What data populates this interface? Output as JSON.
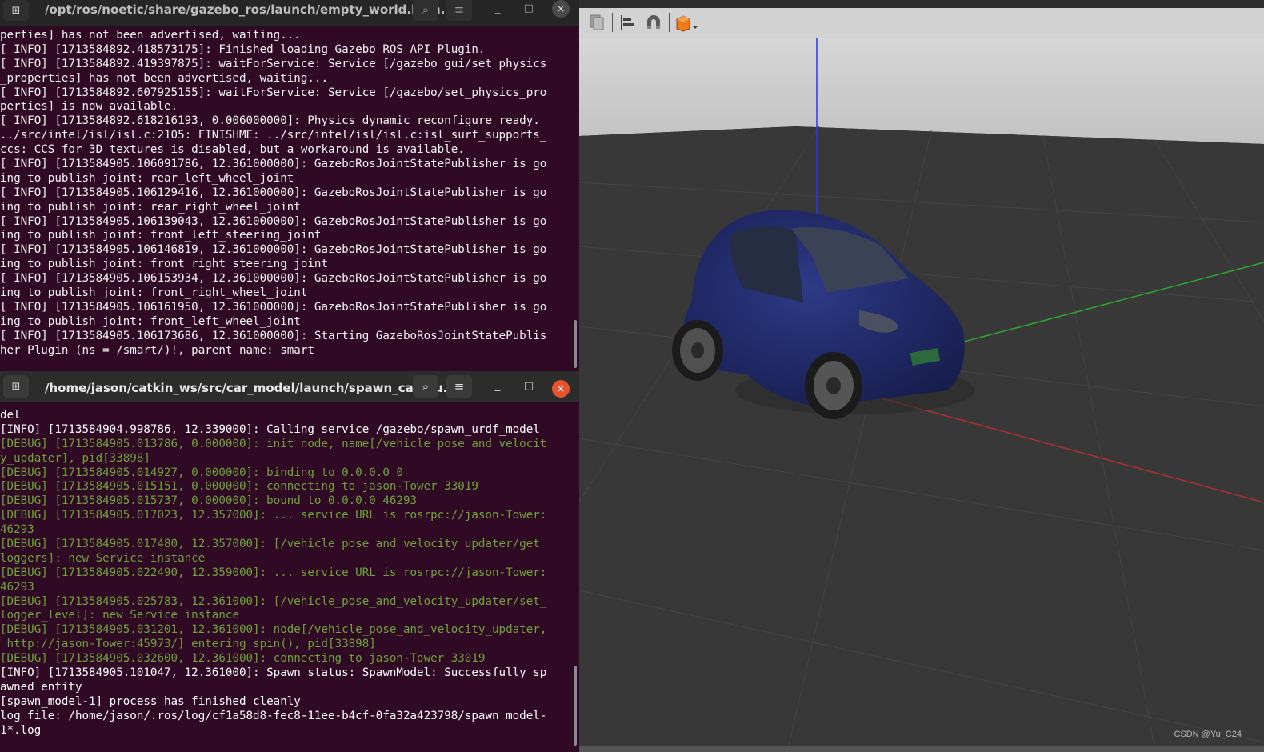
{
  "terminal_top": {
    "title": "/opt/ros/noetic/share/gazebo_ros/launch/empty_world.laun...",
    "lines": [
      {
        "text": "perties] has not been advertised, waiting...",
        "level": "plain"
      },
      {
        "text": "[ INFO] [1713584892.418573175]: Finished loading Gazebo ROS API Plugin.",
        "level": "plain"
      },
      {
        "text": "[ INFO] [1713584892.419397875]: waitForService: Service [/gazebo_gui/set_physics",
        "level": "plain"
      },
      {
        "text": "_properties] has not been advertised, waiting...",
        "level": "plain"
      },
      {
        "text": "[ INFO] [1713584892.607925155]: waitForService: Service [/gazebo/set_physics_pro",
        "level": "plain"
      },
      {
        "text": "perties] is now available.",
        "level": "plain"
      },
      {
        "text": "[ INFO] [1713584892.618216193, 0.006000000]: Physics dynamic reconfigure ready.",
        "level": "plain"
      },
      {
        "text": "../src/intel/isl/isl.c:2105: FINISHME: ../src/intel/isl/isl.c:isl_surf_supports_",
        "level": "plain"
      },
      {
        "text": "ccs: CCS for 3D textures is disabled, but a workaround is available.",
        "level": "plain"
      },
      {
        "text": "[ INFO] [1713584905.106091786, 12.361000000]: GazeboRosJointStatePublisher is go",
        "level": "plain"
      },
      {
        "text": "ing to publish joint: rear_left_wheel_joint",
        "level": "plain"
      },
      {
        "text": "[ INFO] [1713584905.106129416, 12.361000000]: GazeboRosJointStatePublisher is go",
        "level": "plain"
      },
      {
        "text": "ing to publish joint: rear_right_wheel_joint",
        "level": "plain"
      },
      {
        "text": "[ INFO] [1713584905.106139043, 12.361000000]: GazeboRosJointStatePublisher is go",
        "level": "plain"
      },
      {
        "text": "ing to publish joint: front_left_steering_joint",
        "level": "plain"
      },
      {
        "text": "[ INFO] [1713584905.106146819, 12.361000000]: GazeboRosJointStatePublisher is go",
        "level": "plain"
      },
      {
        "text": "ing to publish joint: front_right_steering_joint",
        "level": "plain"
      },
      {
        "text": "[ INFO] [1713584905.106153934, 12.361000000]: GazeboRosJointStatePublisher is go",
        "level": "plain"
      },
      {
        "text": "ing to publish joint: front_right_wheel_joint",
        "level": "plain"
      },
      {
        "text": "[ INFO] [1713584905.106161950, 12.361000000]: GazeboRosJointStatePublisher is go",
        "level": "plain"
      },
      {
        "text": "ing to publish joint: front_left_wheel_joint",
        "level": "plain"
      },
      {
        "text": "[ INFO] [1713584905.106173686, 12.361000000]: Starting GazeboRosJointStatePublis",
        "level": "plain"
      },
      {
        "text": "her Plugin (ns = /smart/)!, parent name: smart",
        "level": "plain"
      }
    ]
  },
  "terminal_bottom": {
    "title": "/home/jason/catkin_ws/src/car_model/launch/spawn_car.lau...",
    "lines": [
      {
        "text": "del",
        "level": "info"
      },
      {
        "text": "[INFO] [1713584904.998786, 12.339000]: Calling service /gazebo/spawn_urdf_model",
        "level": "info"
      },
      {
        "text": "[DEBUG] [1713584905.013786, 0.000000]: init_node, name[/vehicle_pose_and_velocit",
        "level": "debug"
      },
      {
        "text": "y_updater], pid[33898]",
        "level": "debug"
      },
      {
        "text": "[DEBUG] [1713584905.014927, 0.000000]: binding to 0.0.0.0 0",
        "level": "debug"
      },
      {
        "text": "[DEBUG] [1713584905.015151, 0.000000]: connecting to jason-Tower 33019",
        "level": "debug"
      },
      {
        "text": "[DEBUG] [1713584905.015737, 0.000000]: bound to 0.0.0.0 46293",
        "level": "debug"
      },
      {
        "text": "[DEBUG] [1713584905.017023, 12.357000]: ... service URL is rosrpc://jason-Tower:",
        "level": "debug"
      },
      {
        "text": "46293",
        "level": "debug"
      },
      {
        "text": "[DEBUG] [1713584905.017480, 12.357000]: [/vehicle_pose_and_velocity_updater/get_",
        "level": "debug"
      },
      {
        "text": "loggers]: new Service instance",
        "level": "debug"
      },
      {
        "text": "[DEBUG] [1713584905.022490, 12.359000]: ... service URL is rosrpc://jason-Tower:",
        "level": "debug"
      },
      {
        "text": "46293",
        "level": "debug"
      },
      {
        "text": "[DEBUG] [1713584905.025783, 12.361000]: [/vehicle_pose_and_velocity_updater/set_",
        "level": "debug"
      },
      {
        "text": "logger_level]: new Service instance",
        "level": "debug"
      },
      {
        "text": "[DEBUG] [1713584905.031201, 12.361000]: node[/vehicle_pose_and_velocity_updater,",
        "level": "debug"
      },
      {
        "text": " http://jason-Tower:45973/] entering spin(), pid[33898]",
        "level": "debug"
      },
      {
        "text": "[DEBUG] [1713584905.032600, 12.361000]: connecting to jason-Tower 33019",
        "level": "debug"
      },
      {
        "text": "[INFO] [1713584905.101047, 12.361000]: Spawn status: SpawnModel: Successfully sp",
        "level": "info"
      },
      {
        "text": "awned entity",
        "level": "info"
      },
      {
        "text": "[spawn_model-1] process has finished cleanly",
        "level": "info"
      },
      {
        "text": "log file: /home/jason/.ros/log/cf1a58d8-fec8-11ee-b4cf-0fa32a423798/spawn_model-",
        "level": "info"
      },
      {
        "text": "1*.log",
        "level": "info"
      }
    ]
  },
  "icons": {
    "new_tab": "terminal-new-tab-icon",
    "search": "search-icon",
    "menu": "hamburger-menu-icon",
    "minimize": "minimize-icon",
    "maximize": "maximize-icon",
    "close": "close-icon",
    "glyph_new_tab": "⊞",
    "glyph_search": "⌕",
    "glyph_menu": "≡",
    "glyph_minimize": "_",
    "glyph_maximize": "□",
    "glyph_close": "×"
  },
  "gazebo": {
    "toolbar_tools": [
      "copy-icon",
      "align-icon",
      "snap-magnet-icon",
      "view-angle-cube-icon"
    ],
    "watermark": "CSDN @Yu_C24"
  },
  "colors": {
    "terminal_bg": "#300a24",
    "debug_text": "#6fa23a",
    "close_button": "#e6532e",
    "x_axis": "#c0392b",
    "y_axis": "#2fa82f",
    "z_axis": "#2a3bdc",
    "car_body": "#1f2a6b"
  }
}
